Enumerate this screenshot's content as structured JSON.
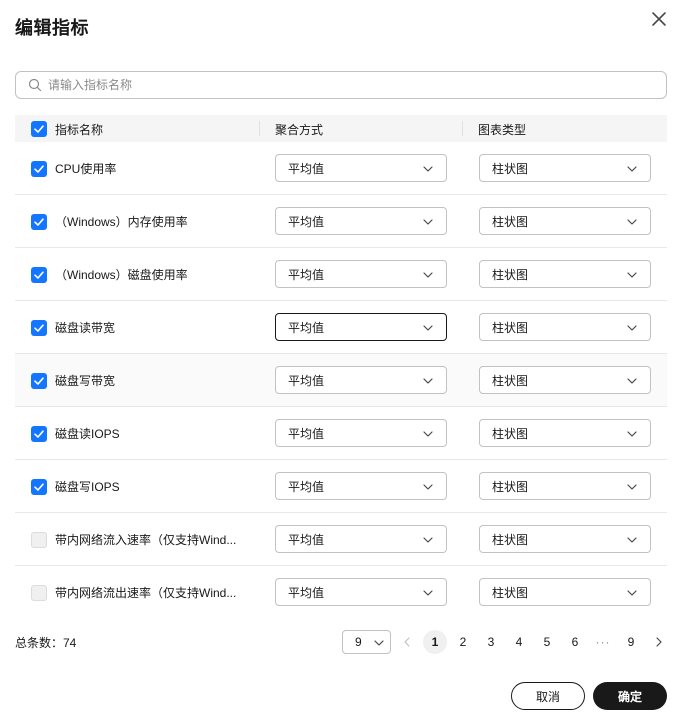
{
  "dialog": {
    "title": "编辑指标",
    "search_placeholder": "请输入指标名称"
  },
  "table": {
    "headers": {
      "name": "指标名称",
      "aggregation": "聚合方式",
      "chart_type": "图表类型"
    },
    "header_checked": true,
    "rows": [
      {
        "name": "CPU使用率",
        "checked": true,
        "aggregation": "平均值",
        "chart_type": "柱状图"
      },
      {
        "name": "（Windows）内存使用率",
        "checked": true,
        "aggregation": "平均值",
        "chart_type": "柱状图"
      },
      {
        "name": "（Windows）磁盘使用率",
        "checked": true,
        "aggregation": "平均值",
        "chart_type": "柱状图"
      },
      {
        "name": "磁盘读带宽",
        "checked": true,
        "aggregation": "平均值",
        "chart_type": "柱状图"
      },
      {
        "name": "磁盘写带宽",
        "checked": true,
        "aggregation": "平均值",
        "chart_type": "柱状图"
      },
      {
        "name": "磁盘读IOPS",
        "checked": true,
        "aggregation": "平均值",
        "chart_type": "柱状图"
      },
      {
        "name": "磁盘写IOPS",
        "checked": true,
        "aggregation": "平均值",
        "chart_type": "柱状图"
      },
      {
        "name": "带内网络流入速率（仅支持Wind...",
        "checked": false,
        "aggregation": "平均值",
        "chart_type": "柱状图"
      },
      {
        "name": "带内网络流出速率（仅支持Wind...",
        "checked": false,
        "aggregation": "平均值",
        "chart_type": "柱状图"
      }
    ]
  },
  "pagination": {
    "total_label": "总条数：74",
    "page_size": "9",
    "pages": [
      "1",
      "2",
      "3",
      "4",
      "5",
      "6",
      "···",
      "9"
    ],
    "current_page": "1"
  },
  "footer": {
    "cancel_label": "取消",
    "ok_label": "确定"
  },
  "colors": {
    "accent": "#1476ff",
    "primary_button": "#191919"
  }
}
